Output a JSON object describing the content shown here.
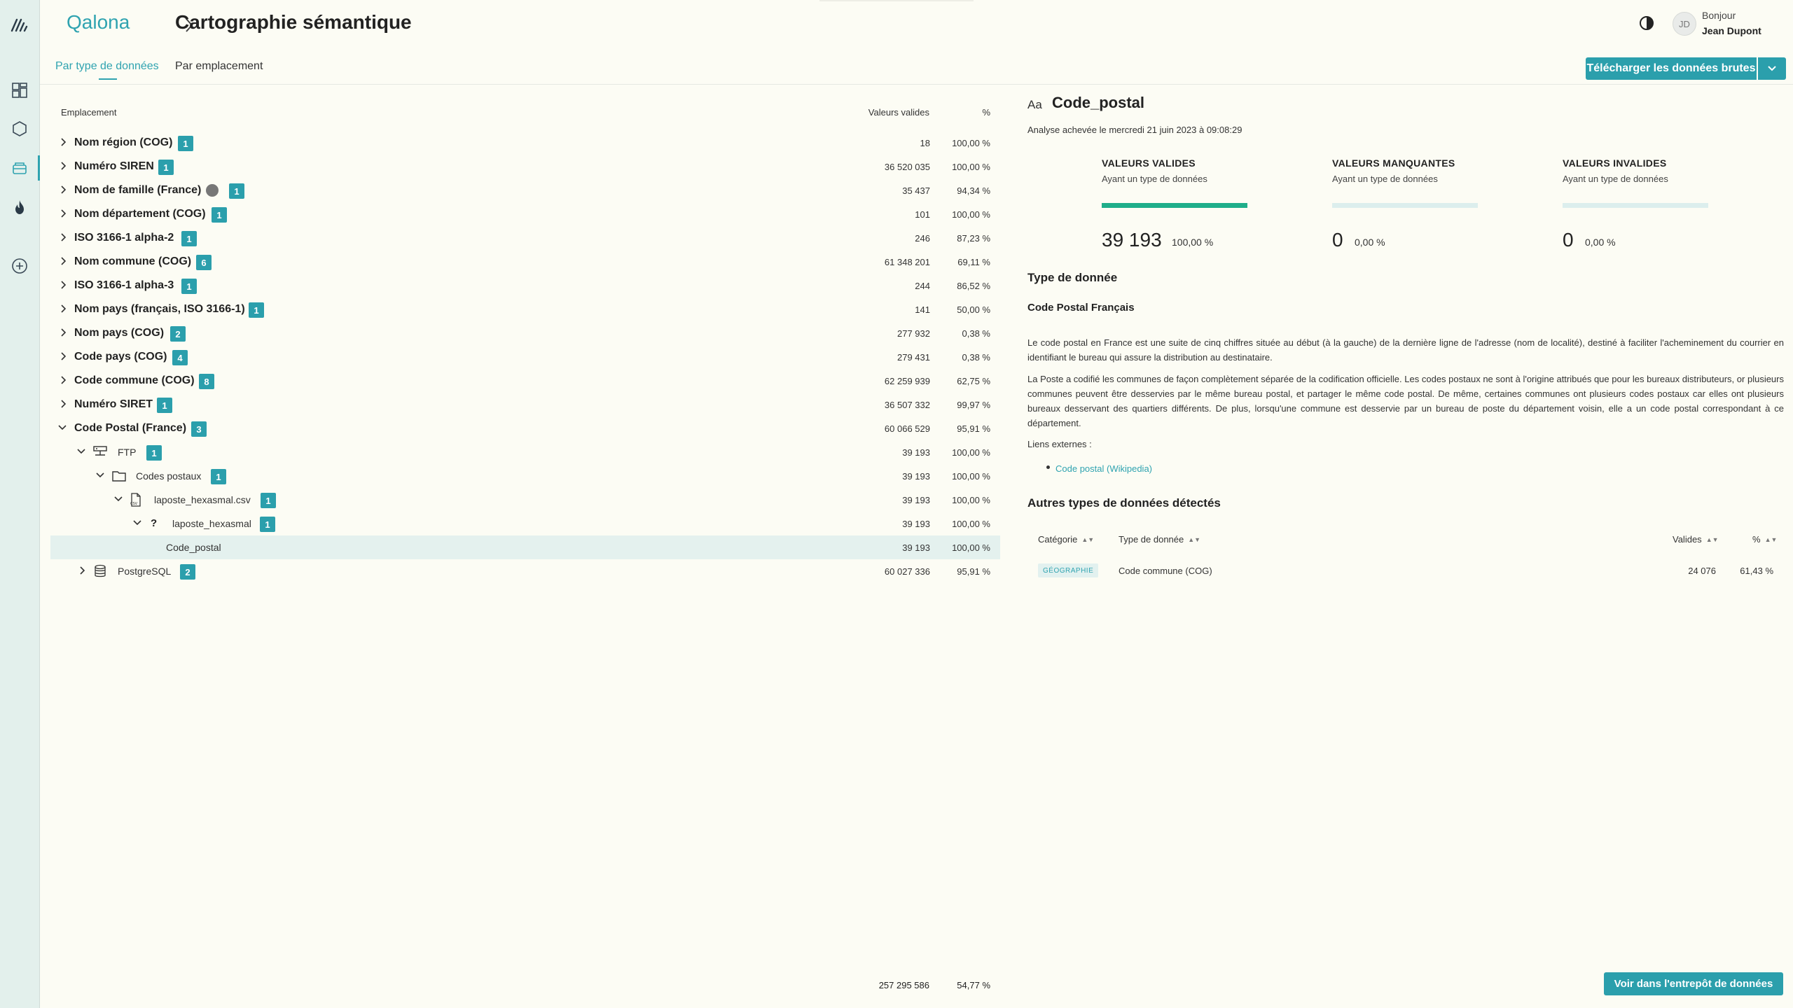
{
  "header": {
    "breadcrumb_root": "Qalona",
    "separator": ">",
    "page_title": "Cartographie sémantique",
    "greeting": "Bonjour",
    "user_name": "Jean Dupont",
    "avatar_initials": "JD"
  },
  "tabs": [
    {
      "label": "Par type de données",
      "active": true
    },
    {
      "label": "Par emplacement",
      "active": false
    }
  ],
  "actions": {
    "download_label": "Télécharger les données brutes",
    "warehouse_label": "Voir dans l'entrepôt de données"
  },
  "tree": {
    "col_location": "Emplacement",
    "col_valid": "Valeurs valides",
    "col_pct": "%",
    "rows": [
      {
        "label": "Nom région (COG)",
        "badge": "1",
        "valid": "18",
        "pct": "100,00 %"
      },
      {
        "label": "Numéro SIREN",
        "badge": "1",
        "valid": "36 520 035",
        "pct": "100,00 %"
      },
      {
        "label": "Nom de famille (France)",
        "badge": "1",
        "valid": "35 437",
        "pct": "94,34 %"
      },
      {
        "label": "Nom département (COG)",
        "badge": "1",
        "valid": "101",
        "pct": "100,00 %"
      },
      {
        "label": "ISO 3166-1 alpha-2",
        "badge": "1",
        "valid": "246",
        "pct": "87,23 %"
      },
      {
        "label": "Nom commune (COG)",
        "badge": "6",
        "valid": "61 348 201",
        "pct": "69,11 %"
      },
      {
        "label": "ISO 3166-1 alpha-3",
        "badge": "1",
        "valid": "244",
        "pct": "86,52 %"
      },
      {
        "label": "Nom pays (français, ISO 3166-1)",
        "badge": "1",
        "valid": "141",
        "pct": "50,00 %"
      },
      {
        "label": "Nom pays (COG)",
        "badge": "2",
        "valid": "277 932",
        "pct": "0,38 %"
      },
      {
        "label": "Code pays (COG)",
        "badge": "4",
        "valid": "279 431",
        "pct": "0,38 %"
      },
      {
        "label": "Code commune (COG)",
        "badge": "8",
        "valid": "62 259 939",
        "pct": "62,75 %"
      },
      {
        "label": "Numéro SIRET",
        "badge": "1",
        "valid": "36 507 332",
        "pct": "99,97 %"
      },
      {
        "label": "Code Postal (France)",
        "badge": "3",
        "valid": "60 066 529",
        "pct": "95,91 %"
      },
      {
        "label": "FTP",
        "badge": "1",
        "valid": "39 193",
        "pct": "100,00 %"
      },
      {
        "label": "Codes postaux",
        "badge": "1",
        "valid": "39 193",
        "pct": "100,00 %"
      },
      {
        "label": "laposte_hexasmal.csv",
        "badge": "1",
        "valid": "39 193",
        "pct": "100,00 %"
      },
      {
        "label": "laposte_hexasmal",
        "badge": "1",
        "valid": "39 193",
        "pct": "100,00 %"
      },
      {
        "label": "Code_postal",
        "badge": "",
        "valid": "39 193",
        "pct": "100,00 %"
      },
      {
        "label": "PostgreSQL",
        "badge": "2",
        "valid": "60 027 336",
        "pct": "95,91 %"
      }
    ],
    "total_valid": "257 295 586",
    "total_pct": "54,77 %"
  },
  "detail": {
    "type_icon": "Aa",
    "name": "Code_postal",
    "analysis": "Analyse achevée le mercredi 21 juin 2023 à 09:08:29",
    "stats": [
      {
        "title": "VALEURS VALIDES",
        "subtitle": "Ayant un type de données",
        "value": "39 193",
        "pct": "100,00 %",
        "fill": 1.0
      },
      {
        "title": "VALEURS MANQUANTES",
        "subtitle": "Ayant un type de données",
        "value": "0",
        "pct": "0,00 %",
        "fill": 0.0
      },
      {
        "title": "VALEURS INVALIDES",
        "subtitle": "Ayant un type de données",
        "value": "0",
        "pct": "0,00 %",
        "fill": 0.0
      }
    ],
    "type_heading": "Type de donnée",
    "type_name": "Code Postal Français",
    "paragraph1": "Le code postal en France est une suite de cinq chiffres située au début (à la gauche) de la dernière ligne de l'adresse (nom de localité), destiné à faciliter l'acheminement du courrier en identifiant le bureau qui assure la distribution au destinataire.",
    "paragraph2": "La Poste a codifié les communes de façon complètement séparée de la codification officielle. Les codes postaux ne sont à l'origine attribués que pour les bureaux distributeurs, or plusieurs communes peuvent être desservies par le même bureau postal, et partager le même code postal. De même, certaines communes ont plusieurs codes postaux car elles ont plusieurs bureaux desservant des quartiers différents. De plus, lorsqu'une commune est desservie par un bureau de poste du département voisin, elle a un code postal correspondant à ce département.",
    "links_label": "Liens externes :",
    "link": "Code postal (Wikipedia)",
    "other_heading": "Autres types de données détectés",
    "other_cols": {
      "category": "Catégorie",
      "type": "Type de donnée",
      "valid": "Valides",
      "pct": "%"
    },
    "other_rows": [
      {
        "category": "GÉOGRAPHIE",
        "type": "Code commune (COG)",
        "valid": "24 076",
        "pct": "61,43 %"
      }
    ]
  },
  "colors": {
    "accent": "#2b9fac",
    "bar_fill": "#1fae8a",
    "sidebar_bg": "#e3f0ec",
    "page_bg": "#fcfcf4"
  }
}
